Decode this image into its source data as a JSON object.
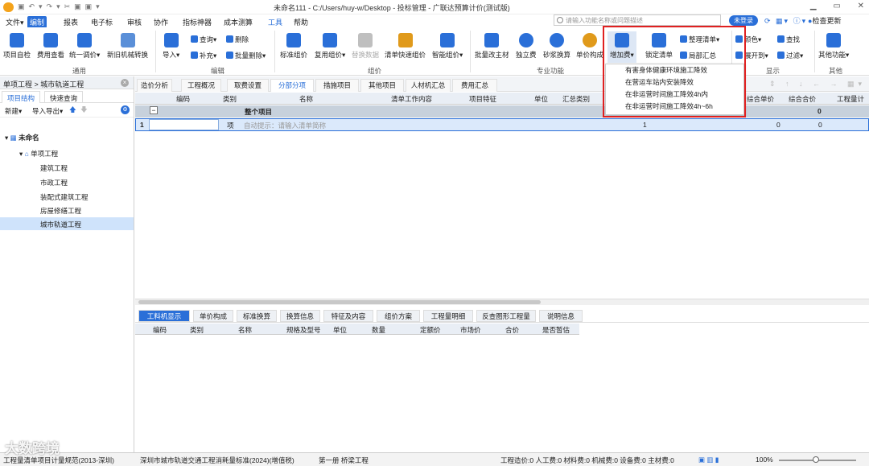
{
  "window": {
    "title": "未命名111 - C:/Users/huy-w/Desktop - 投标管理 - 广联达预算计价(测试版)"
  },
  "menus": [
    "文件▾",
    "编制",
    "报表",
    "电子标",
    "审核",
    "协作",
    "指标神器",
    "成本测算",
    "工具",
    "帮助"
  ],
  "search": {
    "placeholder": "请输入功能名称或问题描述"
  },
  "top_right": {
    "login": "未登录",
    "update": "检查更新"
  },
  "ribbon": {
    "buttons": [
      {
        "label": "项目自检",
        "color": "#2a6fd8"
      },
      {
        "label": "费用查看",
        "color": "#2a6fd8"
      },
      {
        "label": "统一调价▾",
        "color": "#2a6fd8"
      },
      {
        "label": "新旧机械转换",
        "color": "#2a6fd8"
      },
      {
        "label": "导入▾",
        "color": "#2a6fd8"
      },
      {
        "label": "标准组价",
        "color": "#2a6fd8"
      },
      {
        "label": "复用组价▾",
        "color": "#2a6fd8"
      },
      {
        "label": "替换数据",
        "color": "#bfbfbf"
      },
      {
        "label": "清单快速组价",
        "color": "#e09a1b"
      },
      {
        "label": "智能组价▾",
        "color": "#2a6fd8"
      },
      {
        "label": "批量改主材",
        "color": "#2a6fd8"
      },
      {
        "label": "独立费",
        "color": "#2a6fd8"
      },
      {
        "label": "砂浆换算",
        "color": "#2a6fd8"
      },
      {
        "label": "单价构成",
        "color": "#e09a1b"
      },
      {
        "label": "增加费▾",
        "color": "#2a6fd8"
      },
      {
        "label": "锁定清单",
        "color": "#2a6fd8"
      },
      {
        "label": "其他功能▾",
        "color": "#2a6fd8"
      }
    ],
    "small": [
      "查询▾",
      "删除",
      "补充▾",
      "批量删除▾",
      "整理清单▾",
      "局部汇总",
      "颜色▾",
      "查找",
      "展开到▾",
      "过滤▾"
    ],
    "groups": [
      "通用",
      "编辑",
      "组价",
      "专业功能",
      "显示",
      "其他"
    ]
  },
  "dropdown": {
    "items": [
      "有害身体健康环境施工降效",
      "在营运车站内安装降效",
      "在非运营时间施工降效4h内",
      "在非运营时间施工降效4h~6h"
    ]
  },
  "left": {
    "breadcrumb": "单项工程 > 城市轨道工程",
    "tabs": [
      "项目结构",
      "快速查询"
    ],
    "tools": [
      "新建▾",
      "导入导出▾"
    ],
    "tree": {
      "root": "未命名",
      "child": "单项工程",
      "leaves": [
        "建筑工程",
        "市政工程",
        "装配式建筑工程",
        "房屋修缮工程",
        "城市轨道工程"
      ]
    }
  },
  "tabs": [
    "造价分析",
    "工程概况",
    "取费设置",
    "分部分项",
    "措施项目",
    "其他项目",
    "人材机汇总",
    "费用汇总"
  ],
  "grid": {
    "columns": [
      "编码",
      "类别",
      "名称",
      "清单工作内容",
      "项目特征",
      "单位",
      "汇总类别",
      "综合单价",
      "综合合价",
      "工程量计"
    ],
    "group_row": {
      "name": "整个项目",
      "total": "0"
    },
    "row1": {
      "index": "1",
      "category": "项",
      "hint": "自动提示：请输入清单简称",
      "qty": "1",
      "price": "0",
      "total": "0"
    }
  },
  "bottom": {
    "tabs": [
      "工料机显示",
      "单价构成",
      "标准换算",
      "换算信息",
      "特征及内容",
      "组价方案",
      "工程量明细",
      "反查图形工程量",
      "说明信息"
    ],
    "columns": [
      "编码",
      "类别",
      "名称",
      "规格及型号",
      "单位",
      "数量",
      "定额价",
      "市场价",
      "合价",
      "是否暂估"
    ]
  },
  "status": {
    "items": [
      "工程量清单项目计量规范(2013-深圳)",
      "深圳市城市轨道交通工程消耗量标准(2024)(增值税)",
      "第一册 桥梁工程"
    ],
    "costs": "工程造价:0  人工费:0  材料费:0  机械费:0  设备费:0  主材费:0",
    "zoom": "100%"
  },
  "watermark": "大数跨境"
}
